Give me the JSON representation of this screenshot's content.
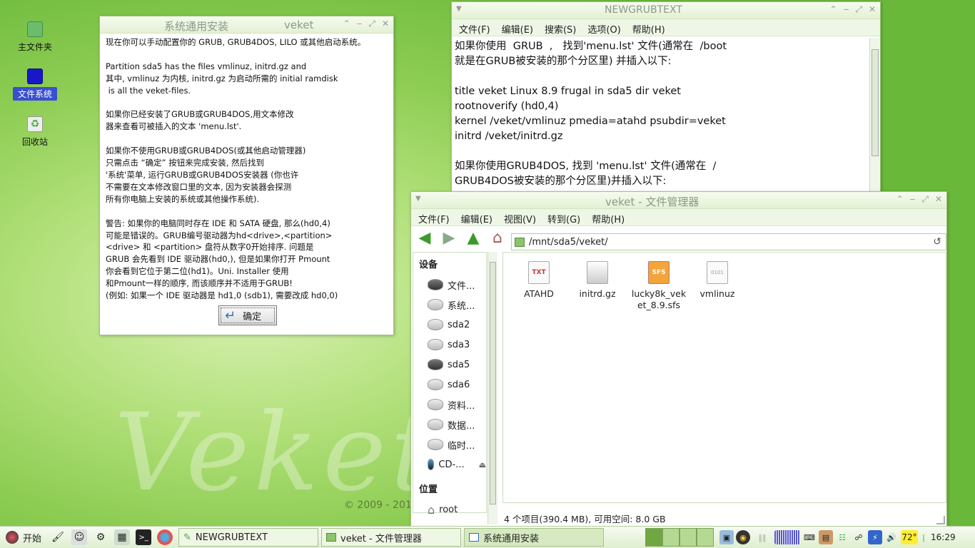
{
  "desktop": {
    "icons": [
      {
        "label": "主文件夹"
      },
      {
        "label": "文件系统"
      },
      {
        "label": "回收站"
      }
    ],
    "watermark": "Veket",
    "copyright": "© 2009 - 201"
  },
  "dialog": {
    "title": "系统通用安装",
    "app": "veket",
    "text": "现在你可以手动配置你的 GRUB, GRUB4DOS, LILO 或其他启动系统。\n\nPartition sda5 has the files vmlinuz, initrd.gz and\n其中, vmlinuz 为内核, initrd.gz 为启动所需的 initial ramdisk\n is all the veket-files.\n\n如果你已经安装了GRUB或GRUB4DOS,用文本修改\n器来查看可被插入的文本 'menu.lst'.\n\n如果你不使用GRUB或GRUB4DOS(或其他启动管理器)\n只需点击 “确定” 按钮来完成安装, 然后找到\n'系统'菜单, 运行GRUB或GRUB4DOS安装器 (你也许\n不需要在文本修改窗口里的文本, 因为安装器会探测\n所有你电脑上安装的系统或其他操作系统).\n\n警告: 如果你的电脑同时存在 IDE 和 SATA 硬盘, 那么(hd0,4)\n可能是错误的。GRUB编号驱动器为hd<drive>,<partition>\n<drive> 和 <partition> 盘符从数字0开始排序. 问题是\nGRUB 会先看到 IDE 驱动器(hd0,), 但是如果你打开 Pmount\n你会看到它位于第二位(hd1)。Uni. Installer 使用\n和Pmount一样的顺序, 而该顺序并不适用于GRUB!\n(例如: 如果一个 IDE 驱动器是 hd1,0 (sdb1), 需要改成 hd0,0)",
    "ok_label": "确定"
  },
  "editor": {
    "title": "NEWGRUBTEXT",
    "menu": [
      "文件(F)",
      "编辑(E)",
      "搜索(S)",
      "选项(O)",
      "帮助(H)"
    ],
    "text": "如果你使用  GRUB  ,   找到'menu.lst' 文件(通常在  /boot\n就是在GRUB被安装的那个分区里) 并插入以下:\n\ntitle veket Linux 8.9 frugal in sda5 dir veket\nrootnoverify (hd0,4)\nkernel /veket/vmlinuz pmedia=atahd psubdir=veket\ninitrd /veket/initrd.gz\n\n如果你使用GRUB4DOS, 找到 'menu.lst' 文件(通常在  /\nGRUB4DOS被安装的那个分区里)并插入以下:"
  },
  "fm": {
    "title": "veket - 文件管理器",
    "menu": [
      "文件(F)",
      "编辑(E)",
      "视图(V)",
      "转到(G)",
      "帮助(H)"
    ],
    "path": "/mnt/sda5/veket/",
    "devices_header": "设备",
    "devices": [
      "文件...",
      "系统...",
      "sda2",
      "sda3",
      "sda5",
      "sda6",
      "资料...",
      "数据...",
      "临时...",
      "CD-..."
    ],
    "places_header": "位置",
    "places": [
      "root"
    ],
    "files": [
      {
        "name": "ATAHD",
        "icon": "TXT"
      },
      {
        "name": "initrd.gz",
        "icon": "archive"
      },
      {
        "name": "lucky8k_veket_8.9.sfs",
        "line1": "lucky8k_vek",
        "line2": "et_8.9.sfs",
        "icon": "SFS"
      },
      {
        "name": "vmlinuz",
        "icon": "binary"
      }
    ],
    "status": "4 个项目(390.4 MB), 可用空间: 8.0 GB"
  },
  "taskbar": {
    "start": "开始",
    "tasks": [
      "NEWGRUBTEXT",
      "veket - 文件管理器",
      "系统通用安装"
    ],
    "temp": "72°",
    "clock": "16:29"
  },
  "colors": {
    "accent": "#3a4fd0",
    "window_border": "#9fc47f",
    "desktop": "#8ccc52"
  }
}
